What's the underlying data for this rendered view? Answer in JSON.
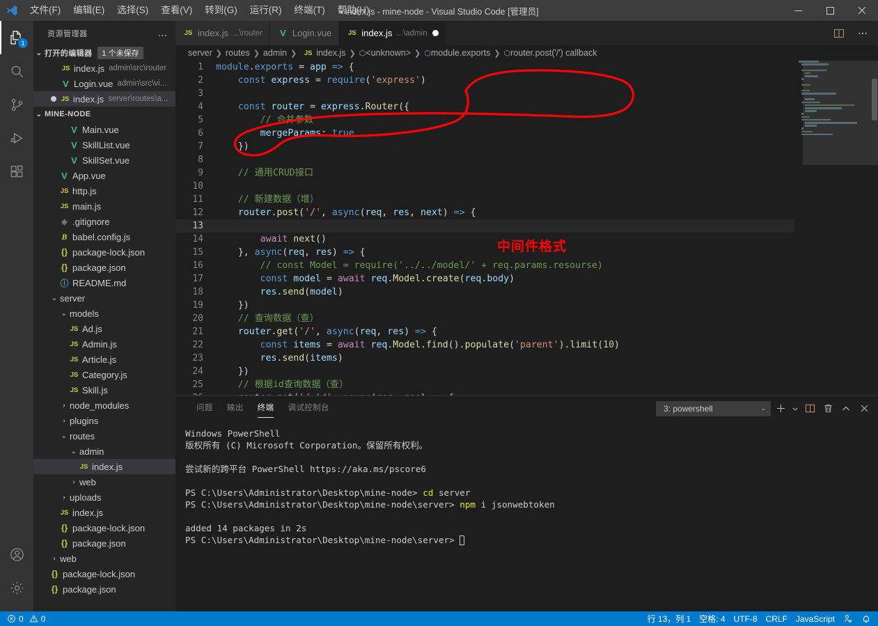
{
  "titlebar": {
    "menus": [
      "文件(F)",
      "编辑(E)",
      "选择(S)",
      "查看(V)",
      "转到(G)",
      "运行(R)",
      "终端(T)",
      "帮助(H)"
    ],
    "title": "index.js - mine-node - Visual Studio Code [管理员]",
    "dirty_marker": "●",
    "window_controls": {
      "minimize": "minimize-icon",
      "maximize": "maximize-icon",
      "close": "close-icon"
    }
  },
  "activitybar": {
    "items": [
      {
        "name": "explorer",
        "icon": "files-icon",
        "badge": "1",
        "active": true
      },
      {
        "name": "search",
        "icon": "search-icon",
        "badge": "",
        "active": false
      },
      {
        "name": "source-control",
        "icon": "source-control-icon",
        "badge": "",
        "active": false
      },
      {
        "name": "run-debug",
        "icon": "run-debug-icon",
        "badge": "",
        "active": false
      },
      {
        "name": "extensions",
        "icon": "extensions-icon",
        "badge": "",
        "active": false
      }
    ],
    "bottom": [
      {
        "name": "accounts",
        "icon": "account-icon"
      },
      {
        "name": "manage",
        "icon": "gear-icon"
      }
    ]
  },
  "sidebar": {
    "header": "资源管理器",
    "more_label": "…",
    "open_editors": {
      "label": "打开的编辑器",
      "badge": "1 个未保存",
      "items": [
        {
          "icon": "js",
          "name": "index.js",
          "path": "admin\\src\\router",
          "dirty": false,
          "selected": false
        },
        {
          "icon": "vue",
          "name": "Login.vue",
          "path": "admin\\src\\vi...",
          "dirty": false,
          "selected": false
        },
        {
          "icon": "js",
          "name": "index.js",
          "path": "server\\routes\\a...",
          "dirty": true,
          "selected": true
        }
      ]
    },
    "project": {
      "label": "MINE-NODE",
      "items": [
        {
          "indent": 3,
          "icon": "vue",
          "name": "Main.vue"
        },
        {
          "indent": 3,
          "icon": "vue",
          "name": "SkillList.vue"
        },
        {
          "indent": 3,
          "icon": "vue",
          "name": "SkillSet.vue"
        },
        {
          "indent": 2,
          "icon": "vue",
          "name": "App.vue"
        },
        {
          "indent": 2,
          "icon": "js",
          "name": "http.js"
        },
        {
          "indent": 2,
          "icon": "js",
          "name": "main.js"
        },
        {
          "indent": 2,
          "icon": "git",
          "name": ".gitignore"
        },
        {
          "indent": 2,
          "icon": "babel",
          "name": "babel.config.js"
        },
        {
          "indent": 2,
          "icon": "json",
          "name": "package-lock.json"
        },
        {
          "indent": 2,
          "icon": "json",
          "name": "package.json"
        },
        {
          "indent": 2,
          "icon": "md",
          "name": "README.md"
        },
        {
          "indent": 1,
          "icon": "folder-open",
          "name": "server"
        },
        {
          "indent": 2,
          "icon": "folder-open",
          "name": "models"
        },
        {
          "indent": 3,
          "icon": "js",
          "name": "Ad.js"
        },
        {
          "indent": 3,
          "icon": "js",
          "name": "Admin.js"
        },
        {
          "indent": 3,
          "icon": "js",
          "name": "Article.js"
        },
        {
          "indent": 3,
          "icon": "js",
          "name": "Category.js"
        },
        {
          "indent": 3,
          "icon": "js",
          "name": "Skill.js"
        },
        {
          "indent": 2,
          "icon": "folder-closed",
          "name": "node_modules"
        },
        {
          "indent": 2,
          "icon": "folder-closed",
          "name": "plugins"
        },
        {
          "indent": 2,
          "icon": "folder-open",
          "name": "routes"
        },
        {
          "indent": 3,
          "icon": "folder-open",
          "name": "admin"
        },
        {
          "indent": 4,
          "icon": "js",
          "name": "index.js",
          "selected": true
        },
        {
          "indent": 3,
          "icon": "folder-closed",
          "name": "web"
        },
        {
          "indent": 2,
          "icon": "folder-closed",
          "name": "uploads"
        },
        {
          "indent": 2,
          "icon": "js",
          "name": "index.js"
        },
        {
          "indent": 2,
          "icon": "json",
          "name": "package-lock.json"
        },
        {
          "indent": 2,
          "icon": "json",
          "name": "package.json"
        },
        {
          "indent": 1,
          "icon": "folder-closed",
          "name": "web"
        },
        {
          "indent": 1,
          "icon": "json",
          "name": "package-lock.json"
        },
        {
          "indent": 1,
          "icon": "json",
          "name": "package.json"
        }
      ]
    }
  },
  "editor": {
    "tabs": [
      {
        "icon": "js",
        "name": "index.js",
        "path": "...\\router",
        "active": false,
        "dirty": false
      },
      {
        "icon": "vue",
        "name": "Login.vue",
        "path": "",
        "active": false,
        "dirty": false
      },
      {
        "icon": "js",
        "name": "index.js",
        "path": "...\\admin",
        "active": true,
        "dirty": true
      }
    ],
    "tab_actions": [
      {
        "name": "split-editor",
        "icon": "split-editor-icon"
      },
      {
        "name": "more-actions",
        "icon": "ellipsis-icon"
      }
    ],
    "breadcrumb": [
      "server",
      "routes",
      "admin",
      "index.js",
      "<unknown>",
      "module.exports",
      "router.post('/') callback"
    ],
    "current_line": 13,
    "lines": [
      {
        "n": 1,
        "text": "module.exports = app => {"
      },
      {
        "n": 2,
        "text": "    const express = require('express')"
      },
      {
        "n": 3,
        "text": ""
      },
      {
        "n": 4,
        "text": "    const router = express.Router({"
      },
      {
        "n": 5,
        "text": "        // 合并参数"
      },
      {
        "n": 6,
        "text": "        mergeParams: true"
      },
      {
        "n": 7,
        "text": "    })"
      },
      {
        "n": 8,
        "text": ""
      },
      {
        "n": 9,
        "text": "    // 通用CRUD接口"
      },
      {
        "n": 10,
        "text": ""
      },
      {
        "n": 11,
        "text": "    // 新建数据（增）"
      },
      {
        "n": 12,
        "text": "    router.post('/', async(req, res, next) => {"
      },
      {
        "n": 13,
        "text": ""
      },
      {
        "n": 14,
        "text": "        await next()"
      },
      {
        "n": 15,
        "text": "    }, async(req, res) => {"
      },
      {
        "n": 16,
        "text": "        // const Model = require('../../model/' + req.params.resourse)"
      },
      {
        "n": 17,
        "text": "        const model = await req.Model.create(req.body)"
      },
      {
        "n": 18,
        "text": "        res.send(model)"
      },
      {
        "n": 19,
        "text": "    })"
      },
      {
        "n": 20,
        "text": "    // 查询数据（查）"
      },
      {
        "n": 21,
        "text": "    router.get('/', async(req, res) => {"
      },
      {
        "n": 22,
        "text": "        const items = await req.Model.find().populate('parent').limit(10)"
      },
      {
        "n": 23,
        "text": "        res.send(items)"
      },
      {
        "n": 24,
        "text": "    })"
      },
      {
        "n": 25,
        "text": "    // 根据id查询数据（查）"
      },
      {
        "n": 26,
        "text": "    router.get('/:id', async(req, res) => {"
      }
    ],
    "annotation": {
      "text": "中间件格式",
      "color": "#ff0000",
      "shape": "hand-drawn-circle"
    }
  },
  "panel": {
    "tabs": [
      "问题",
      "输出",
      "终端",
      "调试控制台"
    ],
    "active_tab": "终端",
    "terminal_select": "3: powershell",
    "actions": [
      {
        "name": "new-terminal",
        "icon": "plus-icon"
      },
      {
        "name": "terminal-dropdown",
        "icon": "chevron-down-icon"
      },
      {
        "name": "split-terminal",
        "icon": "split-icon"
      },
      {
        "name": "kill-terminal",
        "icon": "trash-icon"
      },
      {
        "name": "maximize-panel",
        "icon": "chevron-up-icon"
      },
      {
        "name": "close-panel",
        "icon": "close-icon"
      }
    ],
    "terminal_lines": [
      {
        "text": "Windows PowerShell"
      },
      {
        "text": "版权所有 (C) Microsoft Corporation。保留所有权利。"
      },
      {
        "text": ""
      },
      {
        "text": "尝试新的跨平台 PowerShell https://aka.ms/pscore6"
      },
      {
        "text": ""
      },
      {
        "prompt": "PS C:\\Users\\Administrator\\Desktop\\mine-node> ",
        "cmd": "cd",
        "args": " server"
      },
      {
        "prompt": "PS C:\\Users\\Administrator\\Desktop\\mine-node\\server> ",
        "cmd": "npm",
        "args": " i jsonwebtoken"
      },
      {
        "text": ""
      },
      {
        "text": "added 14 packages in 2s"
      },
      {
        "prompt": "PS C:\\Users\\Administrator\\Desktop\\mine-node\\server> ",
        "cmd": "",
        "args": "",
        "caret": true
      }
    ]
  },
  "statusbar": {
    "errors": "0",
    "warnings": "0",
    "position": "行 13，列 1",
    "indentation": "空格: 4",
    "encoding": "UTF-8",
    "eol": "CRLF",
    "language": "JavaScript",
    "feedback_icon": "feedback-icon",
    "bell_icon": "bell-icon",
    "accent": "#007acc"
  }
}
